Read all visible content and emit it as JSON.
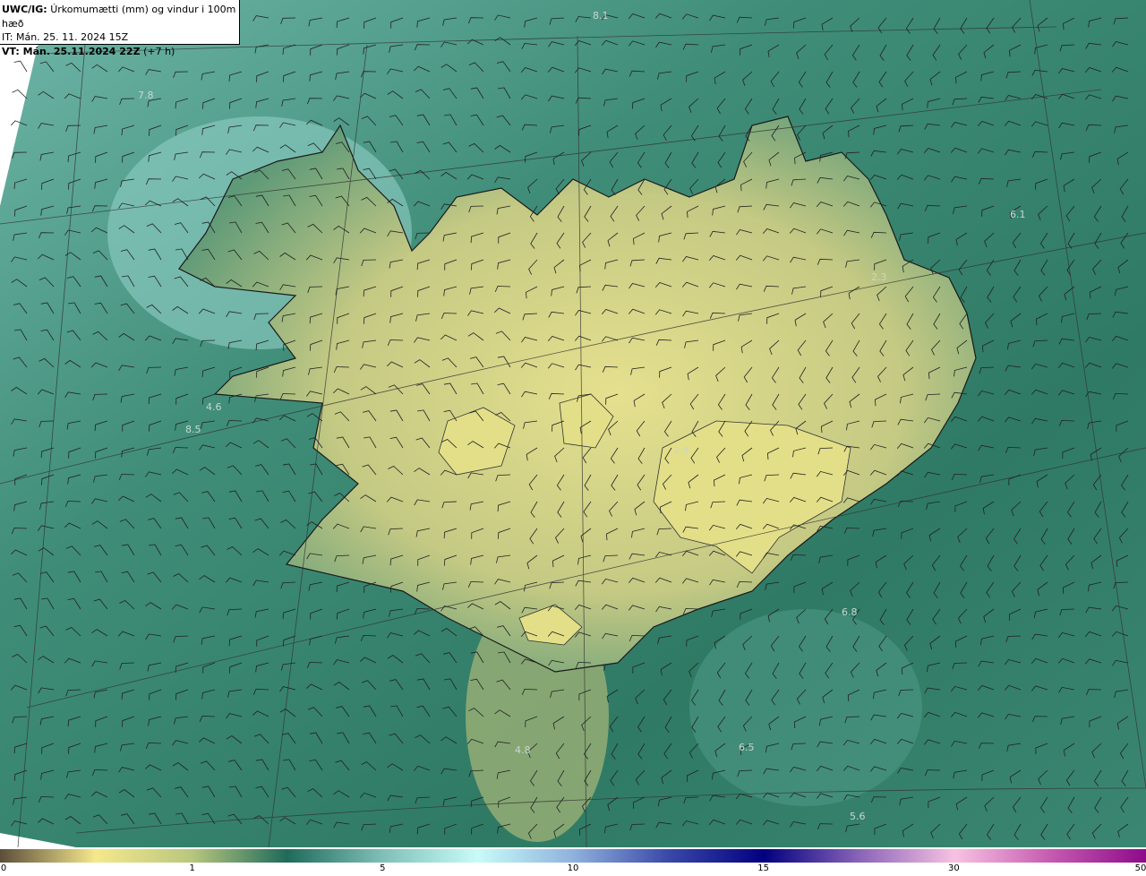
{
  "header": {
    "model": "UWC/IG:",
    "title": "Úrkomumætti (mm) og vindur i 100m hæð",
    "init_time": "IT: Mán. 25. 11. 2024 15Z",
    "valid_label": "VT: Mán. 25.11.2024 22Z",
    "lead": "(+7 h)"
  },
  "colorbar": {
    "ticks": [
      "0",
      "1",
      "5",
      "10",
      "15",
      "30",
      "50"
    ],
    "colors": [
      "#5c4e3a",
      "#f5e88c",
      "#b9c77e",
      "#1f6b5a",
      "#7fbfb8",
      "#c8fbf8",
      "#8fb2dd",
      "#3a48a8",
      "#020080",
      "#8a64b8",
      "#f7c2e2",
      "#c55bb0",
      "#8e0a8a"
    ]
  },
  "map_labels": [
    "8.1",
    "7.8",
    "6.1",
    "2.3",
    "4.6",
    "8.5",
    "2.9",
    "6.8",
    "4.8",
    "6.5",
    "5.6"
  ]
}
